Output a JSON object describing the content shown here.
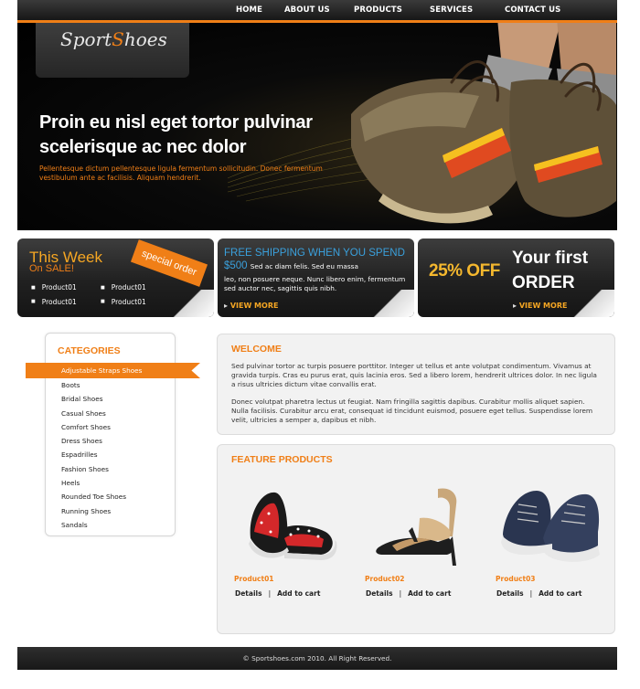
{
  "nav": {
    "items": [
      "HOME",
      "ABOUT US",
      "PRODUCTS",
      "SERVICES",
      "CONTACT US"
    ]
  },
  "logo": {
    "text_part1": "Sport",
    "text_part2": "S",
    "text_part3": "hoes"
  },
  "hero": {
    "title": "Proin eu nisl eget tortor pulvinar scelerisque ac nec dolor",
    "subtitle": "Pellentesque dictum pellentesque ligula fermentum sollicitudin. Donec fermentum vestibulum ante ac facilisis. Aliquam hendrerit."
  },
  "promo1": {
    "this_week": "This Week",
    "on_sale": "On SALE!",
    "badge": "special order",
    "products_col1": [
      "Product01",
      "Product01"
    ],
    "products_col2": [
      "Product01",
      "Product01"
    ]
  },
  "promo2": {
    "heading": "FREE SHIPPING WHEN YOU SPEND $500",
    "body_inline": "Sed ac diam felis. Sed eu massa",
    "body": "leo, non posuere neque. Nunc libero enim, fermentum sed auctor nec, sagittis quis nibh.",
    "view_more": "VIEW MORE"
  },
  "promo3": {
    "percent": "25% OFF",
    "title": "Your first ORDER",
    "view_more": "VIEW MORE"
  },
  "categories": {
    "title": "CATEGORIES",
    "items": [
      "Adjustable Straps Shoes",
      "Boots",
      "Bridal Shoes",
      "Casual Shoes",
      "Comfort Shoes",
      "Dress Shoes",
      "Espadrilles",
      "Fashion Shoes",
      "Heels",
      "Rounded Toe Shoes",
      "Running Shoes",
      "Sandals"
    ],
    "active_index": 0
  },
  "welcome": {
    "title": "WELCOME",
    "p1": "Sed pulvinar tortor ac turpis posuere porttitor. Integer ut tellus et ante volutpat condimentum. Vivamus at gravida turpis. Cras eu purus erat, quis lacinia eros. Sed a libero lorem, hendrerit ultrices dolor. In nec ligula a risus ultricies dictum vitae convallis erat.",
    "p2": "Donec volutpat pharetra lectus ut feugiat. Nam fringilla sagittis dapibus. Curabitur mollis aliquet sapien. Nulla facilisis. Curabitur arcu erat, consequat id tincidunt euismod, posuere eget tellus. Suspendisse lorem velit, ultricies a semper a, dapibus et nibh."
  },
  "featured": {
    "title": "FEATURE PRODUCTS",
    "products": [
      {
        "name": "Product01",
        "details": "Details",
        "sep": "|",
        "cart": "Add to cart"
      },
      {
        "name": "Product02",
        "details": "Details",
        "sep": "|",
        "cart": "Add to cart"
      },
      {
        "name": "Product03",
        "details": "Details",
        "sep": "|",
        "cart": "Add to cart"
      }
    ]
  },
  "footer": {
    "text": "© Sportshoes.com 2010. All Right Reserved."
  },
  "colors": {
    "accent": "#f07f17",
    "blue": "#3aa0dc",
    "dark": "#1a1a1a"
  }
}
